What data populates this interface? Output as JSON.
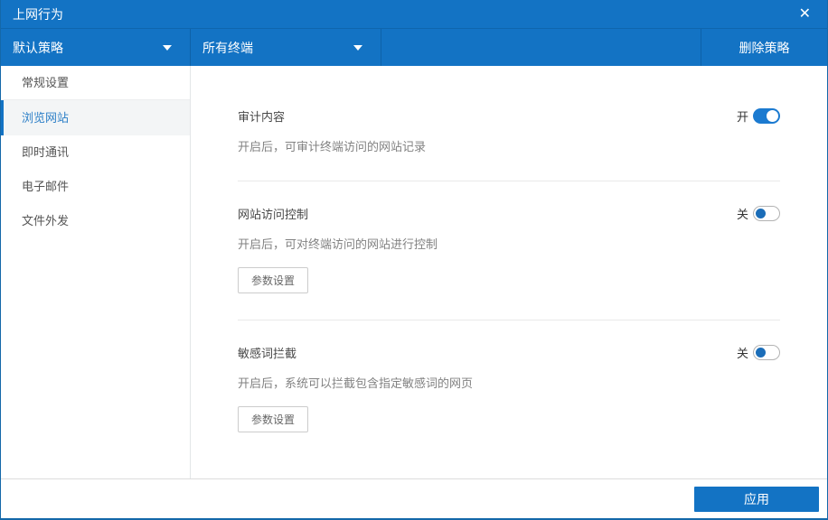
{
  "window": {
    "title": "上网行为",
    "close_icon": "✕"
  },
  "toolbar": {
    "policy_dropdown": {
      "value": "默认策略"
    },
    "terminal_dropdown": {
      "value": "所有终端"
    },
    "delete_button_label": "删除策略"
  },
  "sidebar": {
    "items": [
      {
        "label": "常规设置",
        "selected": false
      },
      {
        "label": "浏览网站",
        "selected": true
      },
      {
        "label": "即时通讯",
        "selected": false
      },
      {
        "label": "电子邮件",
        "selected": false
      },
      {
        "label": "文件外发",
        "selected": false
      }
    ]
  },
  "settings": [
    {
      "title": "审计内容",
      "description": "开启后，可审计终端访问的网站记录",
      "toggle_label": "开",
      "toggle_state": "on"
    },
    {
      "title": "网站访问控制",
      "description": "开启后，可对终端访问的网站进行控制",
      "toggle_label": "关",
      "toggle_state": "off",
      "button_label": "参数设置"
    },
    {
      "title": "敏感词拦截",
      "description": "开启后，系统可以拦截包含指定敏感词的网页",
      "toggle_label": "关",
      "toggle_state": "off",
      "button_label": "参数设置"
    }
  ],
  "footer": {
    "apply_label": "应用"
  },
  "colors": {
    "primary_blue": "#1373c4",
    "toolbar_separator": "#0e62a8",
    "toggle_on": "#1b7ad0",
    "toggle_off_knob": "#1b6db8",
    "selected_item_bg": "#f3f5f6",
    "selected_item_text": "#2e80c8"
  }
}
